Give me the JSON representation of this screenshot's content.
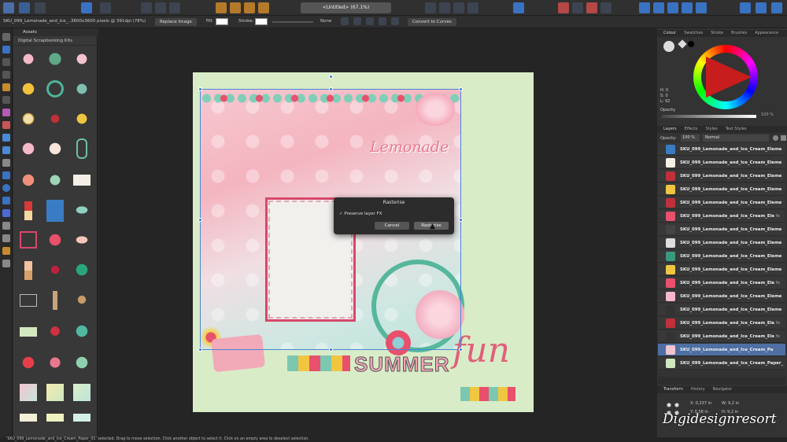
{
  "toolbar": {
    "document_select": "<Untitled> (67.1%)"
  },
  "context": {
    "doc_name": "SKU_099_Lemonade_and_Ice_...",
    "dimensions": "3600x3600 pixels @ 391dpi (78%)",
    "replace_image": "Replace Image",
    "fill_label": "Fill:",
    "stroke_label": "Stroke:",
    "stroke_value": "None",
    "convert_curves": "Convert to Curves"
  },
  "assets": {
    "tab": "Assets",
    "kit": "Digital Scrapbooking Kits"
  },
  "dialog": {
    "title": "Rasterise",
    "checkbox": "Preserve layer FX",
    "cancel": "Cancel",
    "ok": "Rasterise"
  },
  "colour_panel": {
    "tabs": [
      "Colour",
      "Swatches",
      "Stroke",
      "Brushes",
      "Appearance"
    ],
    "h": "H: 0",
    "s": "S: 0",
    "l": "L: 92",
    "opacity_label": "Opacity",
    "opacity_value": "100 %",
    "accent": "#c71d1d"
  },
  "layers_panel": {
    "tabs": [
      "Layers",
      "Effects",
      "Styles",
      "Text Styles"
    ],
    "opacity_label": "Opacity:",
    "opacity_value": "100 %",
    "blend": "Normal",
    "items": [
      {
        "name": "SKU_099_Lemonade_and_Ice_Cream_Eleme",
        "fx": "",
        "sel": false
      },
      {
        "name": "SKU_099_Lemonade_and_Ice_Cream_Eleme",
        "fx": "",
        "sel": false
      },
      {
        "name": "SKU_099_Lemonade_and_Ice_Cream_Eleme",
        "fx": "",
        "sel": false
      },
      {
        "name": "SKU_099_Lemonade_and_Ice_Cream_Eleme",
        "fx": "",
        "sel": false
      },
      {
        "name": "SKU_099_Lemonade_and_Ice_Cream_Eleme",
        "fx": "",
        "sel": false
      },
      {
        "name": "SKU_099_Lemonade_and_Ice_Cream_Ele",
        "fx": "fx",
        "sel": false
      },
      {
        "name": "SKU_099_Lemonade_and_Ice_Cream_Eleme",
        "fx": "",
        "sel": false
      },
      {
        "name": "SKU_099_Lemonade_and_Ice_Cream_Eleme",
        "fx": "",
        "sel": false
      },
      {
        "name": "SKU_099_Lemonade_and_Ice_Cream_Eleme",
        "fx": "",
        "sel": false
      },
      {
        "name": "SKU_099_Lemonade_and_Ice_Cream_Eleme",
        "fx": "",
        "sel": false
      },
      {
        "name": "SKU_099_Lemonade_and_Ice_Cream_Ele",
        "fx": "fx",
        "sel": false
      },
      {
        "name": "SKU_099_Lemonade_and_Ice_Cream_Eleme",
        "fx": "",
        "sel": false
      },
      {
        "name": "SKU_099_Lemonade_and_Ice_Cream_Eleme",
        "fx": "",
        "sel": false
      },
      {
        "name": "SKU_099_Lemonade_and_Ice_Cream_Ele",
        "fx": "fx",
        "sel": false
      },
      {
        "name": "SKU_099_Lemonade_and_Ice_Cream_Ele",
        "fx": "fx",
        "sel": false
      },
      {
        "name": "SKU_099_Lemonade_and_Ice_Cream_Pa",
        "fx": "",
        "sel": true
      },
      {
        "name": "SKU_099_Lemonade_and_Ice_Cream_Paper_",
        "fx": "",
        "sel": false
      }
    ]
  },
  "transform_panel": {
    "tabs": [
      "Transform",
      "History",
      "Navigator"
    ],
    "x": "0,237 in",
    "y": "0,58 in",
    "w": "9,2 in",
    "h": "9,2 in",
    "x_label": "X:",
    "y_label": "Y:",
    "w_label": "W:",
    "h_label": "H:"
  },
  "artwork": {
    "lemonade": "Lemonade",
    "summer": "SUMMER",
    "fun": "fun"
  },
  "status": "'SKU_099_Lemonade_and_Ice_Cream_Paper_01' selected. Drag to move selection. Click another object to select it. Click on an empty area to deselect selection.",
  "watermark": "Digidesignresort"
}
